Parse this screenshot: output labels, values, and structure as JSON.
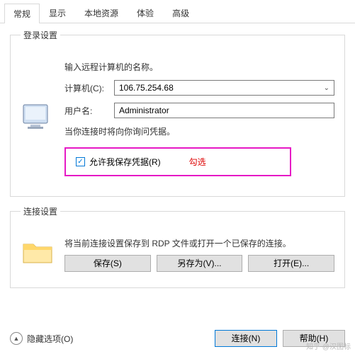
{
  "tabs": {
    "t0": "常规",
    "t1": "显示",
    "t2": "本地资源",
    "t3": "体验",
    "t4": "高级"
  },
  "login": {
    "legend": "登录设置",
    "prompt": "输入远程计算机的名称。",
    "computer_label": "计算机(C):",
    "computer_value": "106.75.254.68",
    "user_label": "用户名:",
    "user_value": "Administrator",
    "note": "当你连接时将向你询问凭据。",
    "checkbox_label": "允许我保存凭据(R)",
    "annotation": "勾选"
  },
  "conn": {
    "legend": "连接设置",
    "desc": "将当前连接设置保存到 RDP 文件或打开一个已保存的连接。",
    "save": "保存(S)",
    "save_as": "另存为(V)...",
    "open": "打开(E)..."
  },
  "footer": {
    "hide": "隐藏选项(O)",
    "connect": "连接(N)",
    "help": "帮助(H)"
  },
  "watermark": "知乎 @汉图标"
}
